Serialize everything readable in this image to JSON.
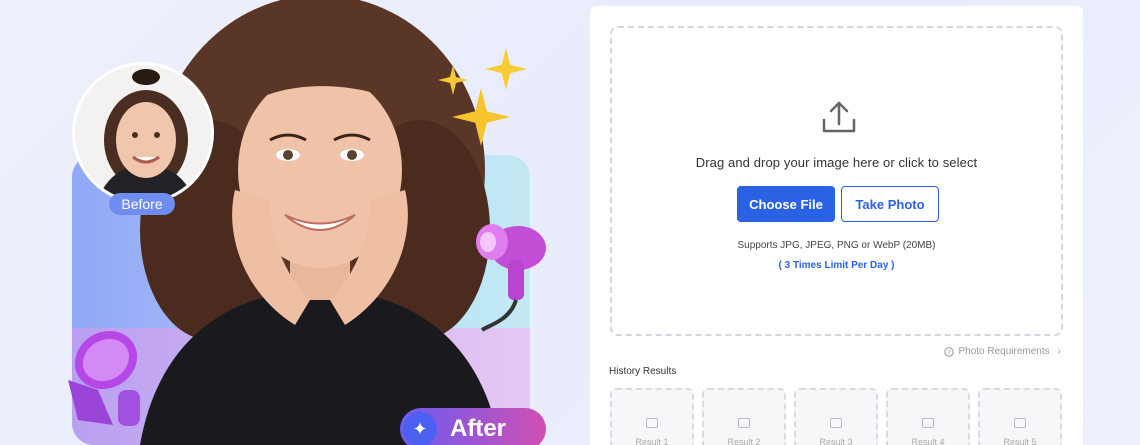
{
  "hero": {
    "before_label": "Before",
    "after_label": "After",
    "after_icon": "magic-wand-icon"
  },
  "upload": {
    "icon": "upload-icon",
    "drop_text": "Drag and drop your image here or click to select",
    "choose_label": "Choose File",
    "photo_label": "Take Photo",
    "supports": "Supports JPG, JPEG, PNG or WebP (20MB)",
    "limit": "( 3 Times Limit Per Day )"
  },
  "requirements": {
    "icon": "help-circle-icon",
    "label": "Photo Requirements",
    "chevron": "chevron-right-icon"
  },
  "history": {
    "title": "History Results",
    "results": [
      {
        "label": "Result 1"
      },
      {
        "label": "Result 2"
      },
      {
        "label": "Result 3"
      },
      {
        "label": "Result 4"
      },
      {
        "label": "Result 5"
      }
    ]
  },
  "colors": {
    "accent": "#2a62e6",
    "after_badge_start": "#6a5cf0",
    "after_badge_end": "#d24fb4",
    "before_badge": "#6f8cf0"
  }
}
